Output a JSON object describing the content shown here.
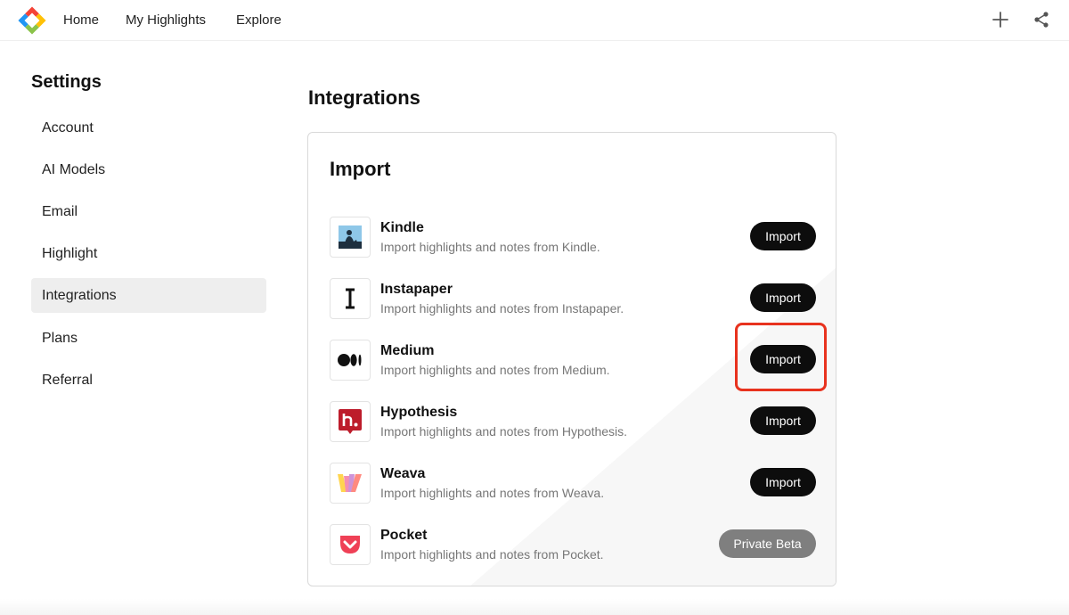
{
  "nav": {
    "links": [
      "Home",
      "My Highlights",
      "Explore"
    ]
  },
  "sidebar": {
    "title": "Settings",
    "items": [
      {
        "label": "Account"
      },
      {
        "label": "AI Models"
      },
      {
        "label": "Email"
      },
      {
        "label": "Highlight"
      },
      {
        "label": "Integrations",
        "active": true
      },
      {
        "label": "Plans"
      },
      {
        "label": "Referral"
      }
    ]
  },
  "main": {
    "title": "Integrations",
    "card_title": "Import",
    "integrations": [
      {
        "name": "Kindle",
        "desc": "Import highlights and notes from Kindle.",
        "action": "Import",
        "icon": "kindle-icon"
      },
      {
        "name": "Instapaper",
        "desc": "Import highlights and notes from Instapaper.",
        "action": "Import",
        "icon": "instapaper-icon"
      },
      {
        "name": "Medium",
        "desc": "Import highlights and notes from Medium.",
        "action": "Import",
        "icon": "medium-icon"
      },
      {
        "name": "Hypothesis",
        "desc": "Import highlights and notes from Hypothesis.",
        "action": "Import",
        "icon": "hypothesis-icon"
      },
      {
        "name": "Weava",
        "desc": "Import highlights and notes from Weava.",
        "action": "Import",
        "icon": "weava-icon"
      },
      {
        "name": "Pocket",
        "desc": "Import highlights and notes from Pocket.",
        "action": "Private Beta",
        "icon": "pocket-icon"
      }
    ]
  },
  "colors": {
    "accent_highlight": "#e8321e",
    "button_dark": "#0d0d0d",
    "button_muted": "#7f7f7f"
  }
}
